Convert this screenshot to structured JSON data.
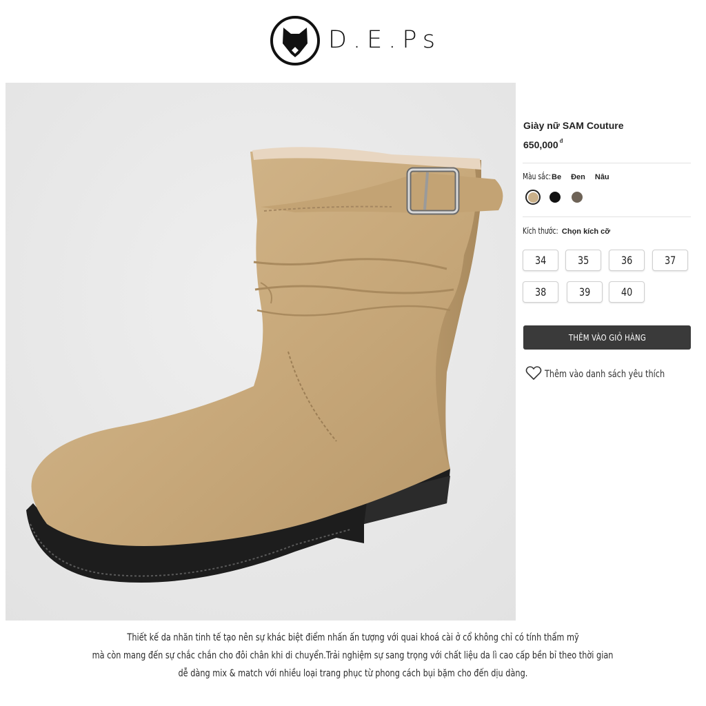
{
  "brand": {
    "name": "D.E.Ps",
    "colors": {
      "text": "#111111"
    }
  },
  "product": {
    "name": "Giày nữ SAM Couture",
    "price": "650,000",
    "currency": "đ",
    "image_icon": "boot-product-image"
  },
  "color_option": {
    "label": "Màu sắc:",
    "options": [
      {
        "name": "Be",
        "hex": "#c9b08a",
        "selected": true
      },
      {
        "name": "Đen",
        "hex": "#111111",
        "selected": false
      },
      {
        "name": "Nâu",
        "hex": "#6e6357",
        "selected": false
      }
    ]
  },
  "size_option": {
    "label": "Kích thước:",
    "prompt": "Chọn kích cỡ",
    "sizes": [
      "34",
      "35",
      "36",
      "37",
      "38",
      "39",
      "40"
    ]
  },
  "actions": {
    "add_to_cart": "THÊM VÀO GIỎ HÀNG",
    "add_to_cart_color": "#3a3a3a",
    "wishlist": "Thêm vào danh sách yêu thích",
    "wishlist_icon": "heart-outline-icon"
  },
  "description": [
    "Thiết kế da nhăn tinh tế tạo nên sự khác biệt điểm nhấn ấn tượng với quai khoá cài ở cổ không chỉ có tính thẩm mỹ",
    "mà còn mang đến sự chắc chắn cho đôi chân khi di chuyển.Trải nghiệm sự sang trọng với chất liệu da lì cao cấp bền bỉ theo thời gian",
    "dễ dàng mix & match với nhiều loại trang phục từ phong cách bụi bặm cho đến dịu dàng."
  ]
}
